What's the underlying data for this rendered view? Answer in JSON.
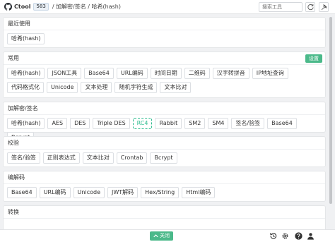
{
  "header": {
    "brand": "Ctool",
    "stars": "583",
    "breadcrumb": "/ 加解密/签名 / 哈希(hash)",
    "search_placeholder": "搜索工具"
  },
  "sections": {
    "recent": {
      "title": "最近使用",
      "tools": [
        "哈希(hash)"
      ]
    },
    "common": {
      "title": "常用",
      "settings_label": "设置",
      "tools": [
        "哈希(hash)",
        "JSON工具",
        "Base64",
        "URL编码",
        "时间日期",
        "二维码",
        "汉字转拼音",
        "IP地址查询",
        "代码格式化",
        "Unicode",
        "文本处理",
        "随机字符生成",
        "文本比对"
      ]
    },
    "crypto": {
      "title": "加解密/签名",
      "tools": [
        "哈希(hash)",
        "AES",
        "DES",
        "Triple DES",
        "RC4",
        "Rabbit",
        "SM2",
        "SM4",
        "签名/验签",
        "Base64",
        "Bcrypt"
      ],
      "active": "RC4"
    },
    "verify": {
      "title": "校验",
      "tools": [
        "签名/验签",
        "正则表达式",
        "文本比对",
        "Crontab",
        "Bcrypt"
      ]
    },
    "encode": {
      "title": "编解码",
      "tools": [
        "Base64",
        "URL编码",
        "Unicode",
        "JWT解码",
        "Hex/String",
        "Html编码"
      ]
    },
    "convert": {
      "title": "转换",
      "tools": []
    }
  },
  "footer": {
    "close_label": "关闭"
  },
  "colors": {
    "accent": "#4bb98a",
    "active_border": "#2dbc8f"
  },
  "icons": [
    "github-icon",
    "refresh-icon",
    "pin-icon",
    "history-icon",
    "settings-icon",
    "help-icon",
    "user-icon",
    "chevron-up-icon"
  ]
}
